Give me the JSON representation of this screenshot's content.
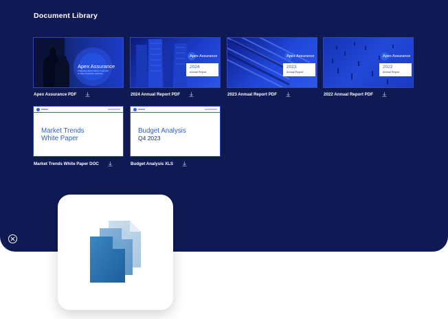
{
  "library": {
    "title": "Document Library",
    "documents": [
      {
        "label": "Apex Assurance PDF",
        "brand": "Apex Assurance",
        "tagline": "Protecting what matters most with smarter insurance solutions"
      },
      {
        "label": "2024 Annual Report PDF",
        "brand": "Apex Assurance",
        "year": "2024",
        "subtitle": "Annual Report"
      },
      {
        "label": "2023 Annual Report PDF",
        "brand": "Apex Assurance",
        "year": "2023",
        "subtitle": "Annual Report"
      },
      {
        "label": "2022 Annual Report PDF",
        "brand": "Apex Assurance",
        "year": "2022",
        "subtitle": "Annual Report"
      },
      {
        "label": "Market Trends White Paper DOC",
        "heading_line1": "Market Trends",
        "heading_line2": "White Paper"
      },
      {
        "label": "Budget Analysis XLS",
        "heading_line1": "Budget Analysis",
        "heading_line2": "Q4 2023"
      }
    ]
  },
  "colors": {
    "panel": "#0f1a55",
    "accent": "#2f5fc2",
    "card_border": "#3447b8"
  },
  "icons": {
    "download": "download-icon",
    "close": "close-icon",
    "app": "documents-icon"
  }
}
